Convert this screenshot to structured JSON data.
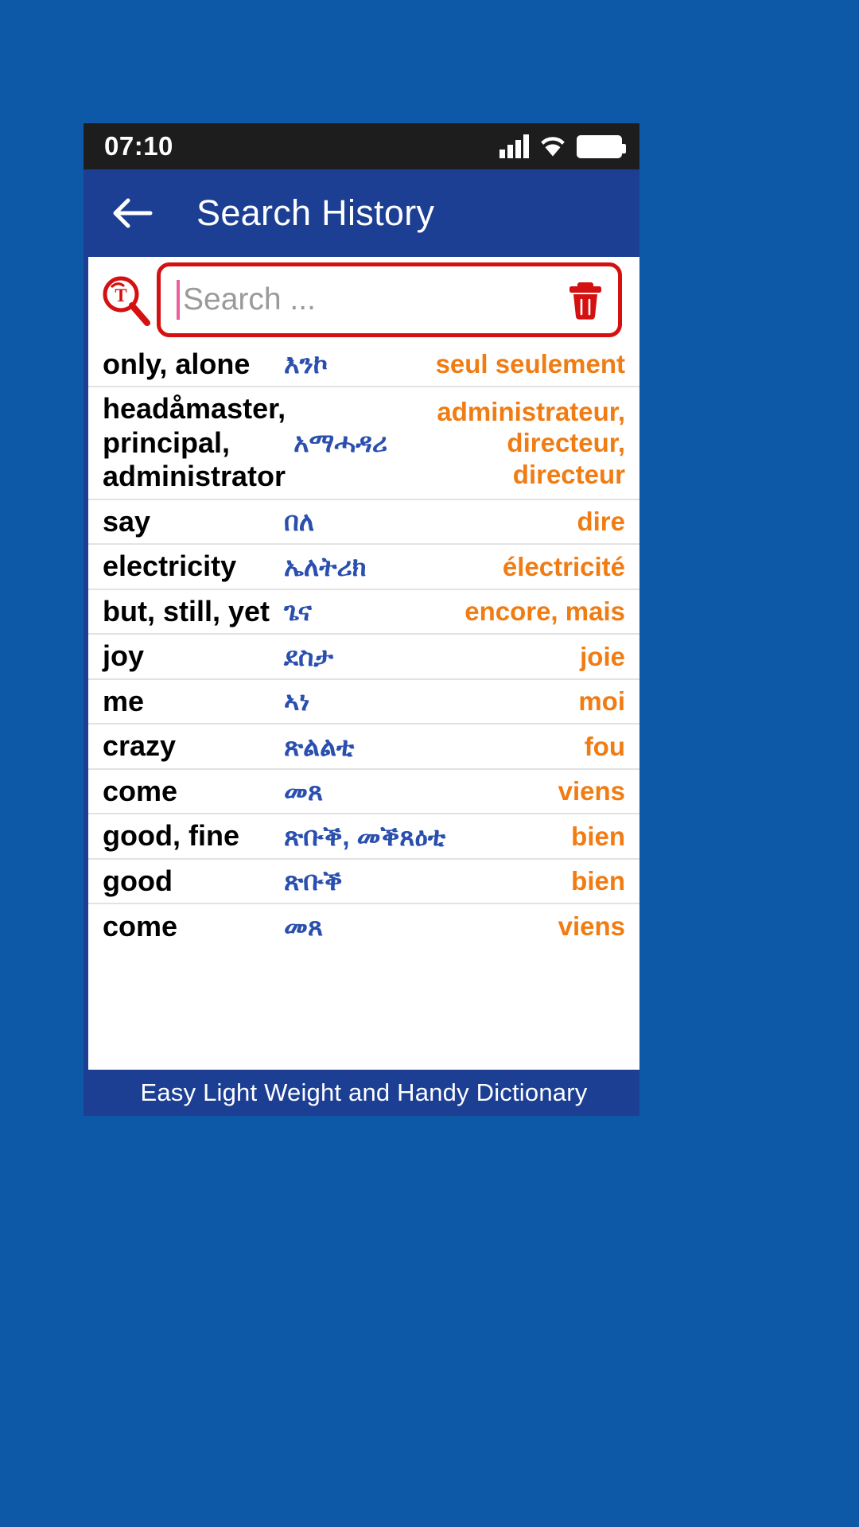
{
  "status_bar": {
    "time": "07:10",
    "icons": [
      "signal-icon",
      "wifi-icon",
      "battery-icon"
    ]
  },
  "app_bar": {
    "back_icon": "back-arrow-icon",
    "title": "Search History"
  },
  "search": {
    "lang_icon": "tigrinya-search-icon",
    "placeholder": "Search ...",
    "value": "",
    "clear_icon": "trash-icon"
  },
  "colors": {
    "page_background": "#0d59a8",
    "app_bar": "#1c3f94",
    "status_bar": "#1d1d1d",
    "search_border": "#d41010",
    "english_text": "#000000",
    "tigrinya_text": "#2a4fae",
    "french_text": "#f07c13",
    "footer": "#1c3f94"
  },
  "history": {
    "rows": [
      {
        "en": "only, alone",
        "ti": "እንኮ",
        "fr": "seul seulement"
      },
      {
        "en": "headåmaster, principal, administrator",
        "ti": "አማሓዳሪ",
        "fr": "administrateur, directeur, directeur"
      },
      {
        "en": "say",
        "ti": "በለ",
        "fr": "dire"
      },
      {
        "en": "electricity",
        "ti": "ኤለትሪክ",
        "fr": "électricité"
      },
      {
        "en": " but, still, yet",
        "ti": "ጌና",
        "fr": "encore,  mais"
      },
      {
        "en": "joy",
        "ti": "ደስታ",
        "fr": "joie"
      },
      {
        "en": "me",
        "ti": "ኣነ",
        "fr": "moi"
      },
      {
        "en": "crazy",
        "ti": "ጽልልቲ",
        "fr": "fou"
      },
      {
        "en": "come",
        "ti": "መጸ",
        "fr": "viens"
      },
      {
        "en": "good, fine",
        "ti": "ጽቡቕ, መቕጸዕቲ",
        "fr": "bien"
      },
      {
        "en": "good",
        "ti": "ጽቡቕ",
        "fr": "bien"
      },
      {
        "en": "come",
        "ti": "መጸ",
        "fr": "viens"
      }
    ]
  },
  "footer": {
    "tagline": "Easy Light Weight and Handy Dictionary"
  }
}
